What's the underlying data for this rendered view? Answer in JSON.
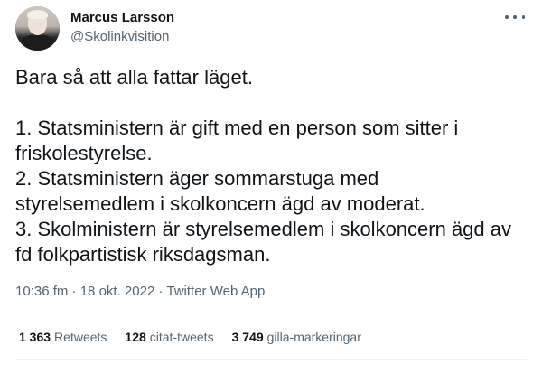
{
  "author": {
    "display_name": "Marcus Larsson",
    "handle": "@Skolinkvisition",
    "avatar": "avatar-photo"
  },
  "tweet": {
    "text": "Bara så att alla fattar läget.\n\n1. Statsministern är gift med en person som sitter i friskolestyrelse.\n2. Statsministern äger sommarstuga med styrelsemedlem i skolkoncern ägd av moderat.\n3. Skolministern är styrelsemedlem i skolkoncern ägd av fd folkpartistisk riksdagsman."
  },
  "meta": {
    "time": "10:36 fm",
    "sep1": "·",
    "date": "18 okt. 2022",
    "sep2": "·",
    "source": "Twitter Web App"
  },
  "stats": {
    "retweets_count": "1 363",
    "retweets_label": "Retweets",
    "quotes_count": "128",
    "quotes_label": "citat-tweets",
    "likes_count": "3 749",
    "likes_label": "gilla-markeringar"
  },
  "icons": {
    "more": "more-horizontal-icon"
  },
  "colors": {
    "text_primary": "#0f1419",
    "text_secondary": "#536471",
    "divider": "#eff3f4"
  }
}
